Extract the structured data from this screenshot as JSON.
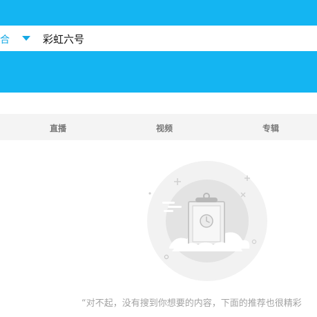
{
  "search": {
    "scope_label": "综合",
    "query": "彩虹六号"
  },
  "tabs": [
    {
      "label": "直播"
    },
    {
      "label": "视频"
    },
    {
      "label": "专辑"
    }
  ],
  "empty_state": {
    "icon": "empty-clipboard-clock-icon",
    "message": "“对不起，没有搜到你想要的内容，下面的推荐也很精彩"
  },
  "colors": {
    "accent": "#14b5f2",
    "accent_text": "#14a8e4",
    "tab_bar_bg": "#f4f4f4",
    "muted_text": "#a3a3a3"
  }
}
